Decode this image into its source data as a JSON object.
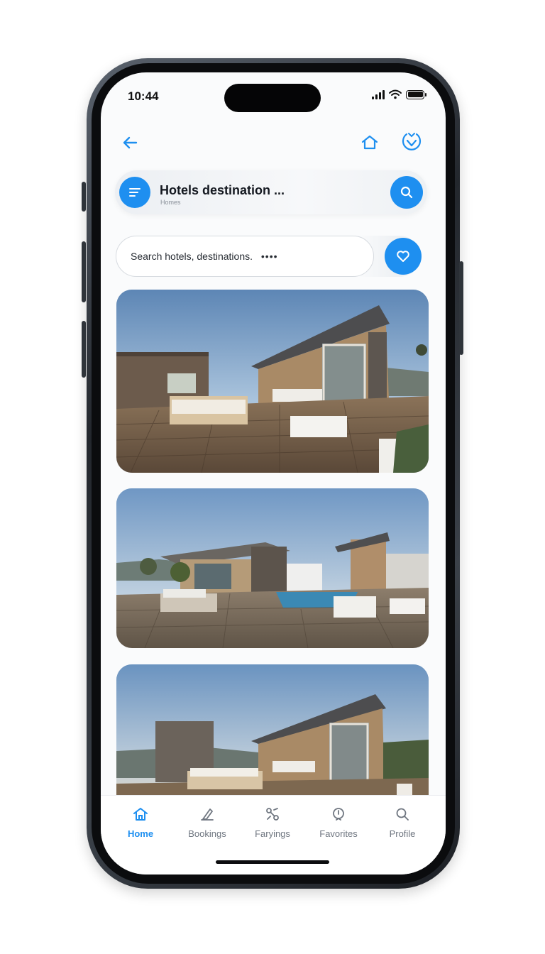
{
  "status_bar": {
    "time": "10:44"
  },
  "top_nav": {
    "back_icon": "arrow-left-icon",
    "home_icon": "home-icon",
    "favorite_icon": "heart-check-icon"
  },
  "header": {
    "title": "Hotels destination ...",
    "subtitle": "Homes",
    "filter_icon": "filter-lines-icon",
    "search_icon": "search-icon"
  },
  "search": {
    "placeholder": "Search hotels, destinations.",
    "more": "••••",
    "heart_icon": "heart-icon"
  },
  "listings": [
    {
      "image": "rooftop-deck-villa-photo"
    },
    {
      "image": "poolside-villa-photo"
    },
    {
      "image": "deck-cabin-photo"
    }
  ],
  "tabs": [
    {
      "label": "Home",
      "icon": "home-icon",
      "active": true
    },
    {
      "label": "Bookings",
      "icon": "bookings-icon",
      "active": false
    },
    {
      "label": "Faryings",
      "icon": "settings-icon",
      "active": false
    },
    {
      "label": "Favorites",
      "icon": "favorites-icon",
      "active": false
    },
    {
      "label": "Profile",
      "icon": "search-icon",
      "active": false
    }
  ],
  "colors": {
    "accent": "#1e8ff0",
    "text_primary": "#141820",
    "tab_inactive": "#6f7680"
  }
}
